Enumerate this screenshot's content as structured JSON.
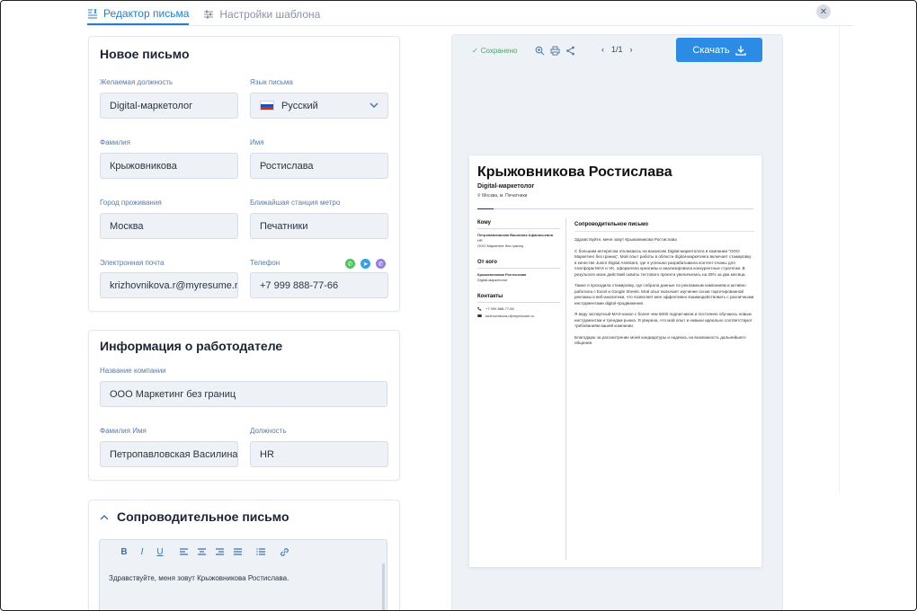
{
  "tabs": [
    {
      "label": "Редактор письма",
      "active": true
    },
    {
      "label": "Настройки шаблона",
      "active": false
    }
  ],
  "new_letter": {
    "title": "Новое письмо",
    "position_label": "Желаемая должность",
    "position_value": "Digital-маркетолог",
    "language_label": "Язык письма",
    "language_value": "Русский",
    "lastname_label": "Фамилия",
    "lastname_value": "Крыжовникова",
    "firstname_label": "Имя",
    "firstname_value": "Ростислава",
    "city_label": "Город проживания",
    "city_value": "Москва",
    "metro_label": "Ближайшая станция метро",
    "metro_value": "Печатники",
    "email_label": "Электронная почта",
    "email_value": "krizhovnikova.r@myresume.ru",
    "phone_label": "Телефон",
    "phone_value": "+7 999 888-77-66"
  },
  "employer": {
    "title": "Информация о работодателе",
    "company_label": "Название компании",
    "company_value": "ООО Маркетинг без границ",
    "contact_label": "Фамилия Имя",
    "contact_value": "Петропавловская Василина",
    "role_label": "Должность",
    "role_value": "HR"
  },
  "cover_letter": {
    "title": "Сопроводительное письмо",
    "text": "Здравствуйте, меня зовут Крыжовникова Ростислава."
  },
  "preview": {
    "saved": "Сохранено",
    "page": "1/1",
    "download": "Скачать"
  },
  "document": {
    "name": "Крыжовникова Ростислава",
    "position": "Digital-маркетолог",
    "location": "Москва, м. Печатники",
    "to_heading": "Кому",
    "to_name": "Петропавловская Василина Афанасьевна",
    "to_role": "HR",
    "to_company": "ООО Маркетинг без границ",
    "from_heading": "От кого",
    "from_name": "Крыжовникова Ростислава",
    "from_role": "Digital-маркетолог",
    "contacts_heading": "Контакты",
    "contact_phone": "+7 999 888-77-66",
    "contact_email": "krizhovnikova.r@myresume.ru",
    "letter_title": "Сопроводительное письмо",
    "p1": "Здравствуйте, меня зовут Крыжовникова Ростислава",
    "p2": "С большим интересом откликаюсь на вакансию Digital-маркетолога в компании \"ООО Маркетинг без границ\". Мой опыт работы в области digital-маркетинга включает стажировку в качестве Junior Digital Assistant, где я успешно разрабатывала контент-планы для платформ MAX и VK, оформляла креативы и анализировала конкурентные стратегии. В результате моих действий охваты тестового проекта увеличились на 35% за два месяца.",
    "p3": "Также я проходила стажировку, где собрала данные по рекламным кампаниям и активно работала с Excel и Google Sheets. Мой опыт включает изучение основ таргетированной рекламы и веб-аналитики, что позволяет мне эффективно взаимодействовать с различными инструментами digital-продвижения.",
    "p4": "Я веду экспертный MAX-канал с более чем 5000 подписчиков и постоянно обучаюсь новым инструментам и трендам рынка. Я уверена, что мой опыт и навыки идеально соответствуют требованиям вашей компании.",
    "p5": "Благодарю за рассмотрение моей кандидатуры и надеюсь на возможность дальнейшего общения."
  },
  "colors": {
    "accent": "#1f7fd6",
    "button": "#2b8be5",
    "field_bg": "#eef2f7",
    "whatsapp": "#4fc25f",
    "telegram": "#3b9de6",
    "viber": "#8f7fe0"
  }
}
